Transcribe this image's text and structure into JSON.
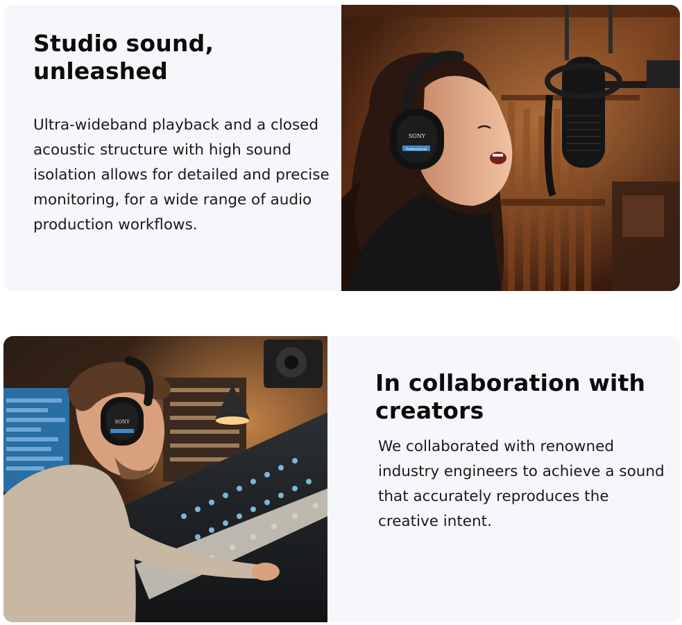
{
  "sections": [
    {
      "headline": "Studio sound, unleashed",
      "body": "Ultra-wideband playback and a closed acoustic structure with high sound isolation allows for detailed and precise monitoring, for a wide range of audio production workflows.",
      "photo": {
        "headphone_brand": "SONY",
        "headphone_model": "Professional"
      }
    },
    {
      "headline": "In collaboration with creators",
      "body": "We collaborated with renowned industry engineers to achieve a sound that accurately reproduces the creative intent.",
      "photo": {
        "headphone_brand": "SONY"
      }
    }
  ],
  "colors": {
    "card_background": "#f6f7fb",
    "headline": "#0b0b0b",
    "body_text": "#1a1a1a"
  }
}
